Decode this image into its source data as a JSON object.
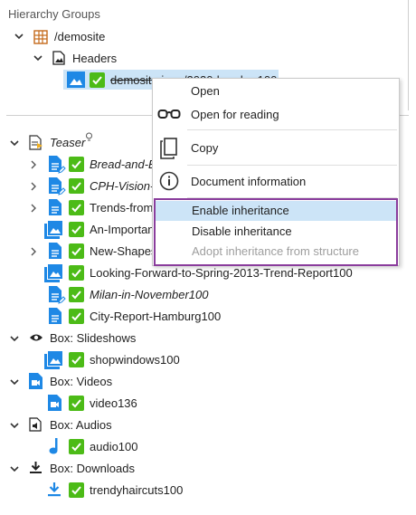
{
  "panel": {
    "title": "Hierarchy Groups",
    "root_label": "/demosite",
    "headers_label": "Headers",
    "header_item_label": "demosite.jpeg/2020-header-100"
  },
  "tree": {
    "teaser_label": "Teaser",
    "teaser_items": [
      "Bread-and-B",
      "CPH-Vision-",
      "Trends-from",
      "An-Importan",
      "New-Shapes",
      "Looking-Forward-to-Spring-2013-Trend-Report100",
      "Milan-in-November100",
      "City-Report-Hamburg100"
    ],
    "slideshows_label": "Box: Slideshows",
    "slideshows_item": "shopwindows100",
    "videos_label": "Box: Videos",
    "videos_item": "video136",
    "audios_label": "Box: Audios",
    "audios_item": "audio100",
    "downloads_label": "Box: Downloads",
    "downloads_item": "trendyhaircuts100"
  },
  "context_menu": {
    "open": "Open",
    "open_for_reading": "Open for reading",
    "copy": "Copy",
    "document_information": "Document information",
    "enable_inheritance": "Enable inheritance",
    "disable_inheritance": "Disable inheritance",
    "adopt_inheritance": "Adopt inheritance from structure"
  },
  "colors": {
    "accent_blue": "#1e88e5",
    "check_green": "#4cbb17",
    "highlight_bg": "#cce4f7",
    "selection_border": "#8a3c9c",
    "disabled_text": "#9e9e9e"
  }
}
